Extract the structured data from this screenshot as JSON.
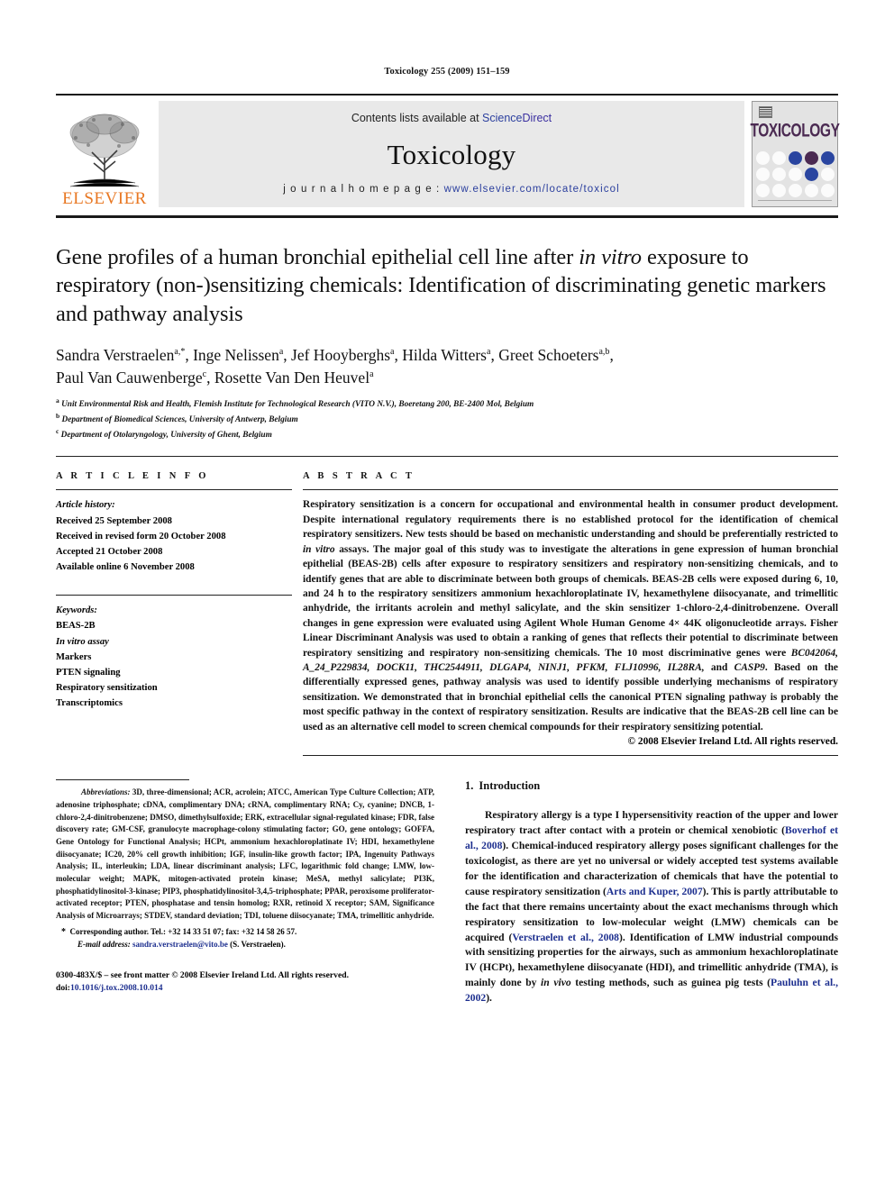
{
  "running_head": "Toxicology 255 (2009) 151–159",
  "banner": {
    "contents_prefix": "Contents lists available at ",
    "sciencedirect_science": "Science",
    "sciencedirect_direct": "Direct",
    "journal_name": "Toxicology",
    "homepage_prefix": "j o u r n a l   h o m e p a g e :   ",
    "homepage_url": "www.elsevier.com/locate/toxicol",
    "publisher_logo_text": "ELSEVIER",
    "cover_title": "TOXICOLOGY",
    "accent_orange": "#E87722",
    "accent_blue": "#2b3f9e",
    "cover_plum": "#4b2a52",
    "cover_blue": "#2a45a0"
  },
  "article": {
    "title_part1": "Gene profiles of a human bronchial epithelial cell line after ",
    "title_italic": "in vitro",
    "title_part2": " exposure to respiratory (non-)sensitizing chemicals: Identification of discriminating genetic markers and pathway analysis",
    "authors_line1": "Sandra Verstraelen",
    "authors_line1_sup": "a,*",
    "authors_full": "Sandra Verstraelen a,*, Inge Nelissen a, Jef Hooyberghs a, Hilda Witters a, Greet Schoeters a,b, Paul Van Cauwenberge c, Rosette Van Den Heuvel a",
    "affiliations": [
      {
        "marker": "a",
        "text": "Unit Environmental Risk and Health, Flemish Institute for Technological Research (VITO N.V.), Boeretang 200, BE-2400 Mol, Belgium"
      },
      {
        "marker": "b",
        "text": "Department of Biomedical Sciences, University of Antwerp, Belgium"
      },
      {
        "marker": "c",
        "text": "Department of Otolaryngology, University of Ghent, Belgium"
      }
    ]
  },
  "article_info": {
    "heading": "A R T I C L E   I N F O",
    "history_label": "Article history:",
    "history": [
      "Received 25 September 2008",
      "Received in revised form 20 October 2008",
      "Accepted 21 October 2008",
      "Available online 6 November 2008"
    ],
    "keywords_label": "Keywords:",
    "keywords": [
      {
        "text": "BEAS-2B",
        "italic": false
      },
      {
        "text": "In vitro assay",
        "italic": true
      },
      {
        "text": "Markers",
        "italic": false
      },
      {
        "text": "PTEN signaling",
        "italic": false
      },
      {
        "text": "Respiratory sensitization",
        "italic": false
      },
      {
        "text": "Transcriptomics",
        "italic": false
      }
    ]
  },
  "abstract": {
    "heading": "A B S T R A C T",
    "p1": "Respiratory sensitization is a concern for occupational and environmental health in consumer product development. Despite international regulatory requirements there is no established protocol for the identification of chemical respiratory sensitizers. New tests should be based on mechanistic understanding and should be preferentially restricted to ",
    "p1_italic": "in vitro",
    "p2": " assays. The major goal of this study was to investigate the alterations in gene expression of human bronchial epithelial (BEAS-2B) cells after exposure to respiratory sensitizers and respiratory non-sensitizing chemicals, and to identify genes that are able to discriminate between both groups of chemicals. BEAS-2B cells were exposed during 6, 10, and 24 h to the respiratory sensitizers ammonium hexachloroplatinate IV, hexamethylene diisocyanate, and trimellitic anhydride, the irritants acrolein and methyl salicylate, and the skin sensitizer 1-chloro-2,4-dinitrobenzene. Overall changes in gene expression were evaluated using Agilent Whole Human Genome 4× 44K oligonucleotide arrays. Fisher Linear Discriminant Analysis was used to obtain a ranking of genes that reflects their potential to discriminate between respiratory sensitizing and respiratory non-sensitizing chemicals. The 10 most discriminative genes were ",
    "genes_italic": "BC042064, A_24_P229834, DOCK11, THC2544911, DLGAP4, NINJ1, PFKM, FLJ10996, IL28RA,",
    "p3": " and ",
    "genes_italic2": "CASP9",
    "p4": ". Based on the differentially expressed genes, pathway analysis was used to identify possible underlying mechanisms of respiratory sensitization. We demonstrated that in bronchial epithelial cells the canonical PTEN signaling pathway is probably the most specific pathway in the context of respiratory sensitization. Results are indicative that the BEAS-2B cell line can be used as an alternative cell model to screen chemical compounds for their respiratory sensitizing potential.",
    "copyright": "© 2008 Elsevier Ireland Ltd. All rights reserved."
  },
  "footnotes": {
    "abbrev_label": "Abbreviations:",
    "abbrev_text": " 3D, three-dimensional; ACR, acrolein; ATCC, American Type Culture Collection; ATP, adenosine triphosphate; cDNA, complimentary DNA; cRNA, complimentary RNA; Cy, cyanine; DNCB, 1-chloro-2,4-dinitrobenzene; DMSO, dimethylsulfoxide; ERK, extracellular signal-regulated kinase; FDR, false discovery rate; GM-CSF, granulocyte macrophage-colony stimulating factor; GO, gene ontology; GOFFA, Gene Ontology for Functional Analysis; HCPt, ammonium hexachloroplatinate IV; HDI, hexamethylene diisocyanate; IC20, 20% cell growth inhibition; IGF, insulin-like growth factor; IPA, Ingenuity Pathways Analysis; IL, interleukin; LDA, linear discriminant analysis; LFC, logarithmic fold change; LMW, low-molecular weight; MAPK, mitogen-activated protein kinase; MeSA, methyl salicylate; PI3K, phosphatidylinositol-3-kinase; PIP3, phosphatidylinositol-3,4,5-triphosphate; PPAR, peroxisome proliferator-activated receptor; PTEN, phosphatase and tensin homolog; RXR, retinoid X receptor; SAM, Significance Analysis of Microarrays; STDEV, standard deviation; TDI, toluene diisocyanate; TMA, trimellitic anhydride.",
    "corresponding": "Corresponding author. Tel.: +32 14 33 51 07; fax: +32 14 58 26 57.",
    "email_label": "E-mail address:",
    "email": "sandra.verstraelen@vito.be",
    "email_suffix": " (S. Verstraelen).",
    "issn_line": "0300-483X/$ – see front matter © 2008 Elsevier Ireland Ltd. All rights reserved.",
    "doi_label": "doi:",
    "doi_value": "10.1016/j.tox.2008.10.014"
  },
  "introduction": {
    "number": "1.",
    "heading": "Introduction",
    "p1_a": "Respiratory allergy is a type I hypersensitivity reaction of the upper and lower respiratory tract after contact with a protein or chemical xenobiotic (",
    "cite1": "Boverhof et al., 2008",
    "p1_b": "). Chemical-induced respiratory allergy poses significant challenges for the toxicologist, as there are yet no universal or widely accepted test systems available for the identification and characterization of chemicals that have the potential to cause respiratory sensitization (",
    "cite2": "Arts and Kuper, 2007",
    "p1_c": "). This is partly attributable to the fact that there remains uncertainty about the exact mechanisms through which respiratory sensitization to low-molecular weight (LMW) chemicals can be acquired (",
    "cite3": "Verstraelen et al., 2008",
    "p1_d": "). Identification of LMW industrial compounds with sensitizing properties for the airways, such as ammonium hexachloroplatinate IV (HCPt), hexamethylene diisocyanate (HDI), and trimellitic anhydride (TMA), is mainly done by ",
    "p1_italic": "in vivo",
    "p1_e": " testing methods, such as guinea pig tests (",
    "cite4": "Pauluhn et al., 2002",
    "p1_f": ")."
  }
}
